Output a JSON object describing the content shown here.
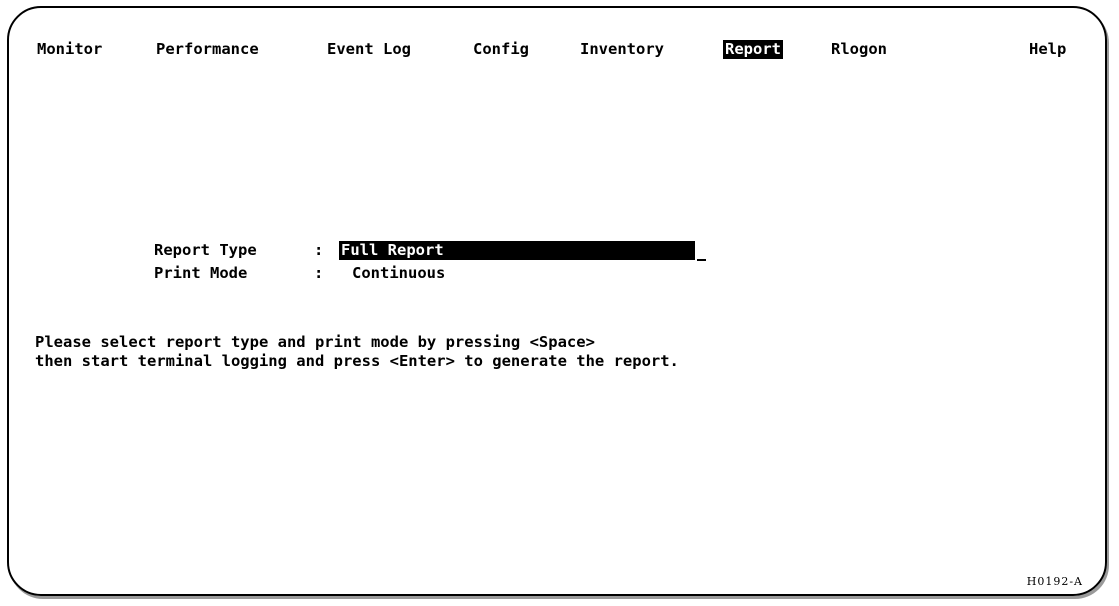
{
  "menu": {
    "items": [
      {
        "label": "Monitor",
        "selected": false
      },
      {
        "label": "Performance",
        "selected": false
      },
      {
        "label": "Event Log",
        "selected": false
      },
      {
        "label": "Config",
        "selected": false
      },
      {
        "label": "Inventory",
        "selected": false
      },
      {
        "label": "Report",
        "selected": true
      },
      {
        "label": "Rlogon",
        "selected": false
      }
    ],
    "help": "Help"
  },
  "form": {
    "separator": ":",
    "report_type": {
      "label": "Report Type",
      "value": "Full Report"
    },
    "print_mode": {
      "label": "Print Mode",
      "value": "Continuous"
    }
  },
  "instructions": {
    "line1": "Please select report type and print mode by pressing <Space>",
    "line2": "then start terminal logging and press <Enter> to generate the report."
  },
  "figure_id": "H0192-A",
  "colors": {
    "background": "#ffffff",
    "foreground": "#000000",
    "highlight_bg": "#000000",
    "highlight_fg": "#ffffff"
  }
}
